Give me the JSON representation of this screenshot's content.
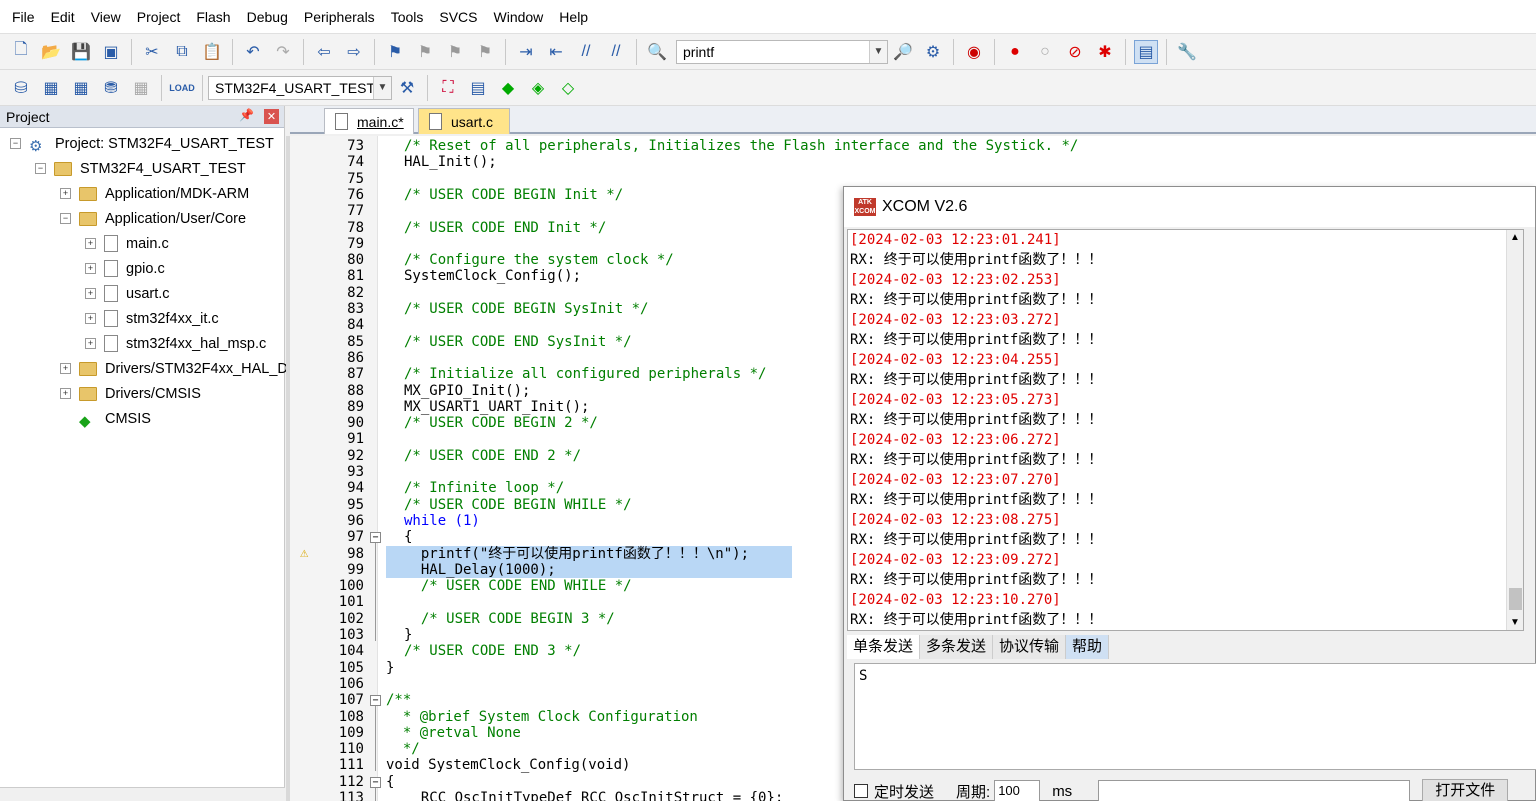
{
  "menubar": [
    "File",
    "Edit",
    "View",
    "Project",
    "Flash",
    "Debug",
    "Peripherals",
    "Tools",
    "SVCS",
    "Window",
    "Help"
  ],
  "toolbar": {
    "find_combo_value": "printf",
    "target_combo_value": "STM32F4_USART_TEST"
  },
  "project_panel": {
    "title": "Project",
    "tree": [
      {
        "label": "Project: STM32F4_USART_TEST",
        "indent": 0,
        "exp": "-",
        "icon": "project-icon"
      },
      {
        "label": "STM32F4_USART_TEST",
        "indent": 1,
        "exp": "-",
        "icon": "target-icon"
      },
      {
        "label": "Application/MDK-ARM",
        "indent": 2,
        "exp": "+",
        "icon": "folder-icon"
      },
      {
        "label": "Application/User/Core",
        "indent": 2,
        "exp": "-",
        "icon": "folder-icon"
      },
      {
        "label": "main.c",
        "indent": 3,
        "exp": "+",
        "icon": "file-icon"
      },
      {
        "label": "gpio.c",
        "indent": 3,
        "exp": "+",
        "icon": "file-icon"
      },
      {
        "label": "usart.c",
        "indent": 3,
        "exp": "+",
        "icon": "file-icon"
      },
      {
        "label": "stm32f4xx_it.c",
        "indent": 3,
        "exp": "+",
        "icon": "file-icon"
      },
      {
        "label": "stm32f4xx_hal_msp.c",
        "indent": 3,
        "exp": "+",
        "icon": "file-icon"
      },
      {
        "label": "Drivers/STM32F4xx_HAL_D",
        "indent": 2,
        "exp": "+",
        "icon": "folder-icon"
      },
      {
        "label": "Drivers/CMSIS",
        "indent": 2,
        "exp": "+",
        "icon": "folder-icon"
      },
      {
        "label": "CMSIS",
        "indent": 2,
        "exp": "",
        "icon": "cmsis-icon"
      }
    ]
  },
  "tabs": [
    {
      "label": "main.c*",
      "active": true
    },
    {
      "label": "usart.c",
      "active": false
    }
  ],
  "code": [
    {
      "n": "73",
      "t": "/* Reset of all peripherals, Initializes the Flash interface and the Systick. */",
      "c": "cm"
    },
    {
      "n": "74",
      "t": "HAL_Init();",
      "c": ""
    },
    {
      "n": "75",
      "t": "",
      "c": ""
    },
    {
      "n": "76",
      "t": "/* USER CODE BEGIN Init */",
      "c": "cm"
    },
    {
      "n": "77",
      "t": "",
      "c": ""
    },
    {
      "n": "78",
      "t": "/* USER CODE END Init */",
      "c": "cm"
    },
    {
      "n": "79",
      "t": "",
      "c": ""
    },
    {
      "n": "80",
      "t": "/* Configure the system clock */",
      "c": "cm"
    },
    {
      "n": "81",
      "t": "SystemClock_Config();",
      "c": ""
    },
    {
      "n": "82",
      "t": "",
      "c": ""
    },
    {
      "n": "83",
      "t": "/* USER CODE BEGIN SysInit */",
      "c": "cm"
    },
    {
      "n": "84",
      "t": "",
      "c": ""
    },
    {
      "n": "85",
      "t": "/* USER CODE END SysInit */",
      "c": "cm"
    },
    {
      "n": "86",
      "t": "",
      "c": ""
    },
    {
      "n": "87",
      "t": "/* Initialize all configured peripherals */",
      "c": "cm"
    },
    {
      "n": "88",
      "t": "MX_GPIO_Init();",
      "c": ""
    },
    {
      "n": "89",
      "t": "MX_USART1_UART_Init();",
      "c": ""
    },
    {
      "n": "90",
      "t": "/* USER CODE BEGIN 2 */",
      "c": "cm"
    },
    {
      "n": "91",
      "t": "",
      "c": ""
    },
    {
      "n": "92",
      "t": "/* USER CODE END 2 */",
      "c": "cm"
    },
    {
      "n": "93",
      "t": "",
      "c": ""
    },
    {
      "n": "94",
      "t": "/* Infinite loop */",
      "c": "cm"
    },
    {
      "n": "95",
      "t": "/* USER CODE BEGIN WHILE */",
      "c": "cm"
    },
    {
      "n": "96",
      "t": "while (1)",
      "c": "kwline"
    },
    {
      "n": "97",
      "t": "{",
      "c": ""
    },
    {
      "n": "98",
      "t": "  printf(\"终于可以使用printf函数了！！！\\n\");",
      "c": "hl"
    },
    {
      "n": "99",
      "t": "  HAL_Delay(1000);",
      "c": "hl"
    },
    {
      "n": "100",
      "t": "  /* USER CODE END WHILE */",
      "c": "cm"
    },
    {
      "n": "101",
      "t": "",
      "c": ""
    },
    {
      "n": "102",
      "t": "  /* USER CODE BEGIN 3 */",
      "c": "cm"
    },
    {
      "n": "103",
      "t": "}",
      "c": ""
    },
    {
      "n": "104",
      "t": "/* USER CODE END 3 */",
      "c": "cm"
    },
    {
      "n": "105",
      "t": "}",
      "c": "root"
    },
    {
      "n": "106",
      "t": "",
      "c": ""
    },
    {
      "n": "107",
      "t": "/**",
      "c": "cmroot"
    },
    {
      "n": "108",
      "t": "  * @brief System Clock Configuration",
      "c": "cmroot"
    },
    {
      "n": "109",
      "t": "  * @retval None",
      "c": "cmroot"
    },
    {
      "n": "110",
      "t": "  */",
      "c": "cmroot"
    },
    {
      "n": "111",
      "t": "void SystemClock_Config(void)",
      "c": "voidline"
    },
    {
      "n": "112",
      "t": "{",
      "c": "root"
    },
    {
      "n": "113",
      "t": "  RCC_OscInitTypeDef RCC_OscInitStruct = {0};",
      "c": ""
    }
  ],
  "xcom": {
    "title": "XCOM V2.6",
    "logo": "ATK XCOM",
    "log": [
      {
        "ts": "[2024-02-03 12:23:01.241]",
        "msg": ""
      },
      {
        "ts": "",
        "msg": "RX: 终于可以使用printf函数了！！！"
      },
      {
        "ts": "[2024-02-03 12:23:02.253]",
        "msg": ""
      },
      {
        "ts": "",
        "msg": "RX: 终于可以使用printf函数了！！！"
      },
      {
        "ts": "[2024-02-03 12:23:03.272]",
        "msg": ""
      },
      {
        "ts": "",
        "msg": "RX: 终于可以使用printf函数了！！！"
      },
      {
        "ts": "[2024-02-03 12:23:04.255]",
        "msg": ""
      },
      {
        "ts": "",
        "msg": "RX: 终于可以使用printf函数了！！！"
      },
      {
        "ts": "[2024-02-03 12:23:05.273]",
        "msg": ""
      },
      {
        "ts": "",
        "msg": "RX: 终于可以使用printf函数了！！！"
      },
      {
        "ts": "[2024-02-03 12:23:06.272]",
        "msg": ""
      },
      {
        "ts": "",
        "msg": "RX: 终于可以使用printf函数了！！！"
      },
      {
        "ts": "[2024-02-03 12:23:07.270]",
        "msg": ""
      },
      {
        "ts": "",
        "msg": "RX: 终于可以使用printf函数了！！！"
      },
      {
        "ts": "[2024-02-03 12:23:08.275]",
        "msg": ""
      },
      {
        "ts": "",
        "msg": "RX: 终于可以使用printf函数了！！！"
      },
      {
        "ts": "[2024-02-03 12:23:09.272]",
        "msg": ""
      },
      {
        "ts": "",
        "msg": "RX: 终于可以使用printf函数了！！！"
      },
      {
        "ts": "[2024-02-03 12:23:10.270]",
        "msg": ""
      },
      {
        "ts": "",
        "msg": "RX: 终于可以使用printf函数了！！！"
      }
    ],
    "send_tabs": [
      "单条发送",
      "多条发送",
      "协议传输",
      "帮助"
    ],
    "send_text": "S",
    "timed_send_label": "定时发送",
    "period_label": "周期:",
    "period_value": "100",
    "period_unit": "ms",
    "open_file_button": "打开文件"
  },
  "colors": {
    "comment": "#007f00",
    "keyword": "#0000ff",
    "timestamp": "#e00000",
    "highlight": "#b9d7f5"
  }
}
